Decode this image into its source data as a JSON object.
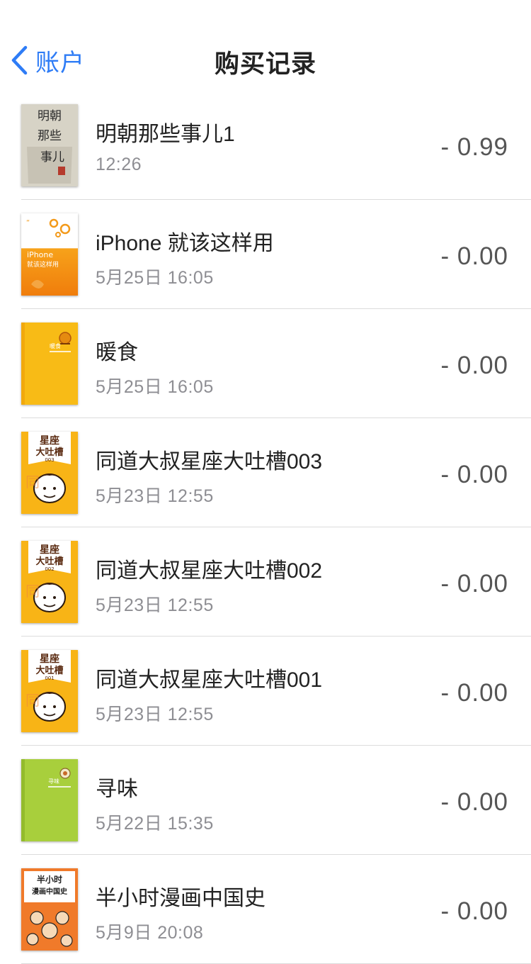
{
  "nav": {
    "back_label": "账户",
    "title": "购买记录"
  },
  "colors": {
    "accent": "#2e7cf6",
    "title_text": "#222222",
    "secondary_text": "#8e8e93",
    "divider": "#dcdcdc"
  },
  "purchases": [
    {
      "title": "明朝那些事儿1",
      "time": "12:26",
      "price": "- 0.99"
    },
    {
      "title": "iPhone 就该这样用",
      "time": "5月25日 16:05",
      "price": "- 0.00"
    },
    {
      "title": "暖食",
      "time": "5月25日 16:05",
      "price": "- 0.00"
    },
    {
      "title": "同道大叔星座大吐槽003",
      "time": "5月23日 12:55",
      "price": "- 0.00"
    },
    {
      "title": "同道大叔星座大吐槽002",
      "time": "5月23日 12:55",
      "price": "- 0.00"
    },
    {
      "title": "同道大叔星座大吐槽001",
      "time": "5月23日 12:55",
      "price": "- 0.00"
    },
    {
      "title": "寻味",
      "time": "5月22日 15:35",
      "price": "- 0.00"
    },
    {
      "title": "半小时漫画中国史",
      "time": "5月9日 20:08",
      "price": "- 0.00"
    }
  ],
  "covers": {
    "ming": {
      "lines": [
        "明朝",
        "那些",
        "事儿"
      ]
    },
    "iphone": {
      "lines": [
        "iPhone",
        "就该这样用"
      ]
    },
    "nuanshi": {
      "lines": [
        "暖食"
      ]
    },
    "xingzuo": {
      "lines": [
        "星座",
        "大吐槽",
        "003",
        "002",
        "001"
      ]
    },
    "xunwei": {
      "lines": [
        "寻味"
      ]
    },
    "banxiaoshi": {
      "lines": [
        "半小时",
        "漫画中国史"
      ]
    }
  }
}
